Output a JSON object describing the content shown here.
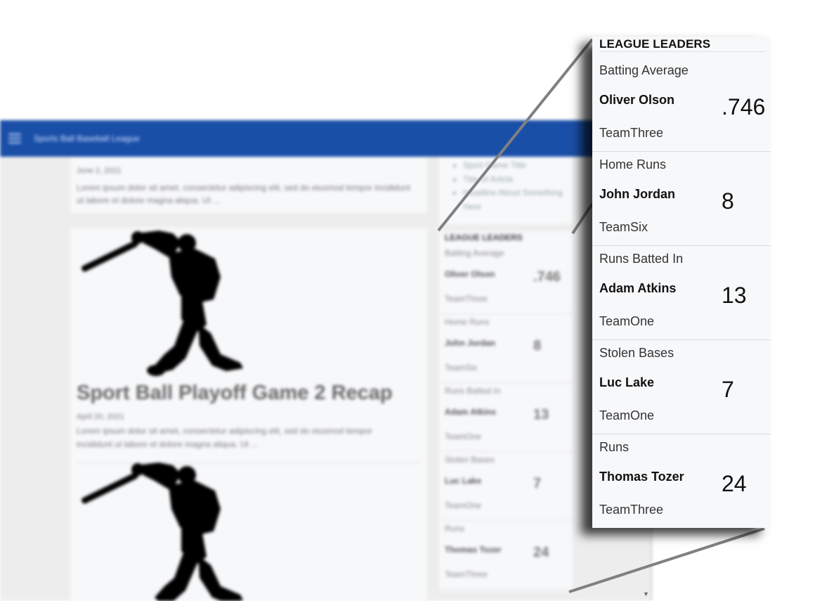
{
  "app": {
    "title": "Sports Ball Baseball League",
    "menu_icon": "hamburger-menu-icon"
  },
  "posts": [
    {
      "date": "June 2, 2021",
      "excerpt": "Lorem ipsum dolor sit amet, consectetur adipiscing elit, sed do eiusmod tempor incididunt ut labore et dolore magna aliqua. Ut ..."
    },
    {
      "image_icon": "baseball-batter-silhouette",
      "title": "Sport Ball Playoff Game 2 Recap",
      "date": "April 20, 2021",
      "excerpt": "Lorem ipsum dolor sit amet, consectetur adipiscing elit, sed do eiusmod tempor incididunt ut labore et dolore magna aliqua. Ut ..."
    },
    {
      "image_icon": "baseball-batter-silhouette"
    }
  ],
  "sidebar": {
    "links": [
      "Sport Game Title",
      "Title of Article",
      "Headline About Something Here"
    ]
  },
  "league_leaders": {
    "heading": "LEAGUE LEADERS",
    "items": [
      {
        "category": "Batting Average",
        "player": "Oliver Olson",
        "team": "TeamThree",
        "value": ".746"
      },
      {
        "category": "Home Runs",
        "player": "John Jordan",
        "team": "TeamSix",
        "value": "8"
      },
      {
        "category": "Runs Batted In",
        "player": "Adam Atkins",
        "team": "TeamOne",
        "value": "13"
      },
      {
        "category": "Stolen Bases",
        "player": "Luc Lake",
        "team": "TeamOne",
        "value": "7"
      },
      {
        "category": "Runs",
        "player": "Thomas Tozer",
        "team": "TeamThree",
        "value": "24"
      }
    ]
  },
  "colors": {
    "header_blue": "#1a4fa8",
    "panel_background": "#f7f8fa",
    "page_background": "#ededed"
  }
}
